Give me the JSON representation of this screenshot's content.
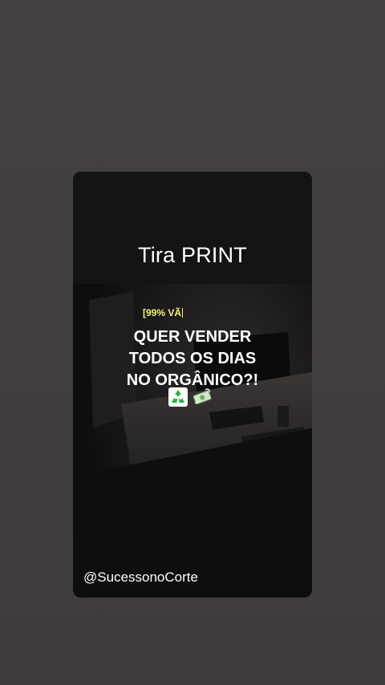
{
  "colors": {
    "page_background": "#433f41",
    "card_background": "#121112",
    "accent_yellow": "#f3f27a",
    "text_white": "#ffffff"
  },
  "story": {
    "title": "Tira PRINT",
    "subtitle": "[99% VÃ",
    "headline_lines": [
      "QUER VENDER",
      "TODOS OS DIAS",
      "NO ORGÂNICO?!"
    ],
    "emojis": [
      "recycle-icon",
      "money-icon"
    ],
    "handle": "@SucessonoCorte"
  }
}
